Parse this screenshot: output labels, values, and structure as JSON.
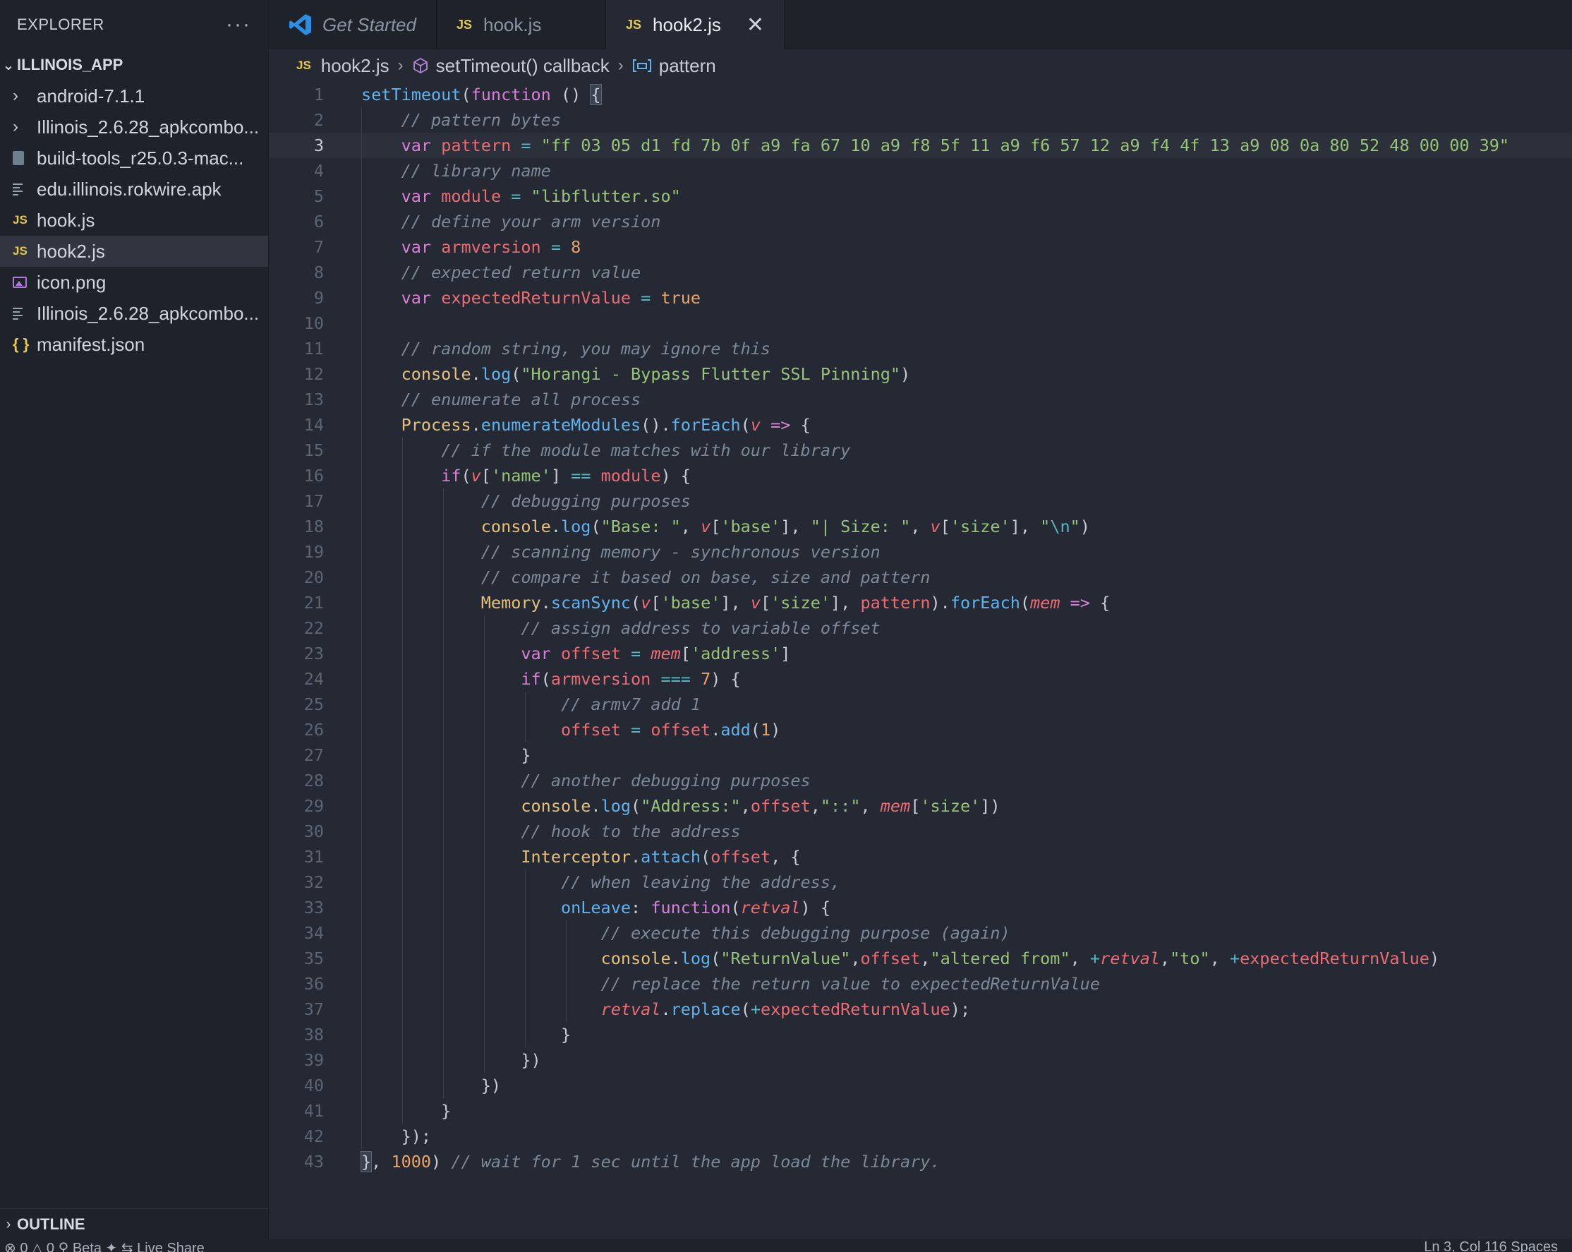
{
  "explorer": {
    "title": "EXPLORER",
    "more_label": "···",
    "project": "ILLINOIS_APP",
    "items": [
      {
        "label": "android-7.1.1",
        "icon": "chevron-right-icon"
      },
      {
        "label": "Illinois_2.6.28_apkcombo...",
        "icon": "chevron-right-icon"
      },
      {
        "label": "build-tools_r25.0.3-mac...",
        "icon": "archive-icon"
      },
      {
        "label": "edu.illinois.rokwire.apk",
        "icon": "file-lines-icon"
      },
      {
        "label": "hook.js",
        "icon": "js-icon",
        "badge": "JS"
      },
      {
        "label": "hook2.js",
        "icon": "js-icon",
        "badge": "JS"
      },
      {
        "label": "icon.png",
        "icon": "image-icon"
      },
      {
        "label": "Illinois_2.6.28_apkcombo...",
        "icon": "file-lines-icon"
      },
      {
        "label": "manifest.json",
        "icon": "json-icon",
        "badge": "{ }"
      }
    ],
    "outline": "OUTLINE"
  },
  "tabs": [
    {
      "label": "Get Started"
    },
    {
      "label": "hook.js",
      "badge": "JS"
    },
    {
      "label": "hook2.js",
      "badge": "JS",
      "close": "✕"
    }
  ],
  "breadcrumb": {
    "file": "hook2.js",
    "file_badge": "JS",
    "sep": "›",
    "symbol1": "setTimeout() callback",
    "symbol2": "pattern"
  },
  "code": {
    "line_numbers": [
      "1",
      "2",
      "3",
      "4",
      "5",
      "6",
      "7",
      "8",
      "9",
      "10",
      "11",
      "12",
      "13",
      "14",
      "15",
      "16",
      "17",
      "18",
      "19",
      "20",
      "21",
      "22",
      "23",
      "24",
      "25",
      "26",
      "27",
      "28",
      "29",
      "30",
      "31",
      "32",
      "33",
      "34",
      "35",
      "36",
      "37",
      "38",
      "39",
      "40",
      "41",
      "42",
      "43"
    ],
    "current_line": 3,
    "text": {
      "l1_setTimeout": "setTimeout",
      "l1_paren": "(",
      "l1_function": "function",
      "l1_rest": " () ",
      "l1_brace": "{",
      "l2": "// pattern bytes",
      "kw_var": "var",
      "eq": " = ",
      "l3_name": "pattern",
      "l3_value": "\"ff 03 05 d1 fd 7b 0f a9 fa 67 10 a9 f8 5f 11 a9 f6 57 12 a9 f4 4f 13 a9 08 0a 80 52 48 00 00 39\"",
      "l4": "// library name",
      "l5_name": "module",
      "l5_value": "\"libflutter.so\"",
      "l6": "// define your arm version",
      "l7_name": "armversion",
      "l7_value": "8",
      "l8": "// expected return value",
      "l9_name": "expectedReturnValue",
      "l9_value": "true",
      "l11": "// random string, you may ignore this",
      "console": "console",
      "dot": ".",
      "log": "log",
      "l12_str": "\"Horangi - Bypass Flutter SSL Pinning\"",
      "l13": "// enumerate all process",
      "l14_Process": "Process",
      "l14_enum": "enumerateModules",
      "l14_mid": "().",
      "forEach": "forEach",
      "l14_v": "v",
      "arrow": " => ",
      "l15": "// if the module matches with our library",
      "kw_if": "if",
      "l16_name": "'name'",
      "l16_eqeq": " == ",
      "l17": "// debugging purposes",
      "l18_s1": "\"Base: \"",
      "l18_base": "'base'",
      "l18_s2": "\"| Size: \"",
      "l18_size": "'size'",
      "l18_s3a": "\"",
      "l18_esc": "\\n",
      "l18_s3b": "\"",
      "l19": "// scanning memory - synchronous version",
      "l20": "// compare it based on base, size and pattern",
      "l21_Memory": "Memory",
      "l21_scan": "scanSync",
      "l21_mem": "mem",
      "l22": "// assign address to variable offset",
      "l23_offset": "offset",
      "l23_addr": "'address'",
      "l24_eqeqeq": " === ",
      "l24_seven": "7",
      "l25": "// armv7 add 1",
      "l26_add": "add",
      "l26_one": "1",
      "l28": "// another debugging purposes",
      "l29_s1": "\"Address:\"",
      "l29_s2": "\"::\"",
      "l30": "// hook to the address",
      "l31_Interceptor": "Interceptor",
      "l31_attach": "attach",
      "l32": "// when leaving the address,",
      "l33_onLeave": "onLeave",
      "l33_retval": "retval",
      "l34": "// execute this debugging purpose (again)",
      "l35_s1": "\"ReturnValue\"",
      "l35_s2": "\"altered from\"",
      "l35_s3": "\"to\"",
      "plus": "+",
      "l36": "// replace the return value to expectedReturnValue",
      "l37_replace": "replace",
      "l43_num": "1000",
      "l43_comment": "// wait for 1 sec until the app load the library."
    }
  },
  "status": {
    "left": "⊗ 0 △ 0   ⚲ Beta ✦   ⇆ Live Share",
    "right": "Ln 3, Col 116   Spaces"
  }
}
